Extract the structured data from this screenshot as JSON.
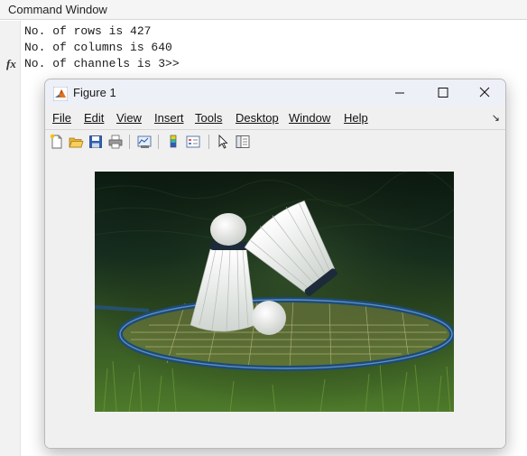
{
  "command_window": {
    "title": "Command Window",
    "lines": [
      "No. of rows is 427",
      "No. of columns is 640",
      "No. of channels is 3>>"
    ],
    "prompt_icon": "fx"
  },
  "figure": {
    "title": "Figure 1",
    "menu": [
      "File",
      "Edit",
      "View",
      "Insert",
      "Tools",
      "Desktop",
      "Window",
      "Help"
    ],
    "toolbar_icons": [
      "new-figure-icon",
      "open-file-icon",
      "save-icon",
      "print-icon",
      "link-plot-icon",
      "colorbar-icon",
      "legend-icon",
      "select-arrow-icon",
      "property-inspector-icon"
    ],
    "image_subject": "badminton shuttlecocks on racket"
  },
  "colors": {
    "accent": "#2f5fb4",
    "titlebar": "#eef0f8",
    "window_bg": "#f0f0f0"
  }
}
